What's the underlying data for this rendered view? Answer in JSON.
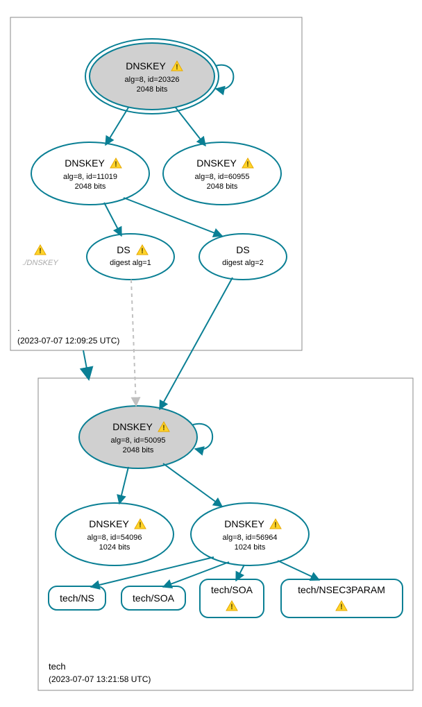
{
  "zones": {
    "root": {
      "label": ".",
      "timestamp": "(2023-07-07 12:09:25 UTC)"
    },
    "tech": {
      "label": "tech",
      "timestamp": "(2023-07-07 13:21:58 UTC)"
    }
  },
  "nodes": {
    "root_ksk": {
      "title": "DNSKEY",
      "line1": "alg=8, id=20326",
      "line2": "2048 bits",
      "warn": true
    },
    "root_zsk1": {
      "title": "DNSKEY",
      "line1": "alg=8, id=11019",
      "line2": "2048 bits",
      "warn": true
    },
    "root_zsk2": {
      "title": "DNSKEY",
      "line1": "alg=8, id=60955",
      "line2": "2048 bits",
      "warn": true
    },
    "ds1": {
      "title": "DS",
      "line1": "digest alg=1",
      "warn": true
    },
    "ds2": {
      "title": "DS",
      "line1": "digest alg=2",
      "warn": false
    },
    "ghost": {
      "title": "./DNSKEY",
      "warn": true
    },
    "tech_ksk": {
      "title": "DNSKEY",
      "line1": "alg=8, id=50095",
      "line2": "2048 bits",
      "warn": true
    },
    "tech_zsk1": {
      "title": "DNSKEY",
      "line1": "alg=8, id=54096",
      "line2": "1024 bits",
      "warn": true
    },
    "tech_zsk2": {
      "title": "DNSKEY",
      "line1": "alg=8, id=56964",
      "line2": "1024 bits",
      "warn": true
    },
    "rr_ns": {
      "title": "tech/NS"
    },
    "rr_soa": {
      "title": "tech/SOA"
    },
    "rr_soa2": {
      "title": "tech/SOA",
      "warn": true
    },
    "rr_nsec3": {
      "title": "tech/NSEC3PARAM",
      "warn": true
    }
  },
  "colors": {
    "accent": "#0a7f94",
    "fill_grey": "#d0d0d0"
  }
}
